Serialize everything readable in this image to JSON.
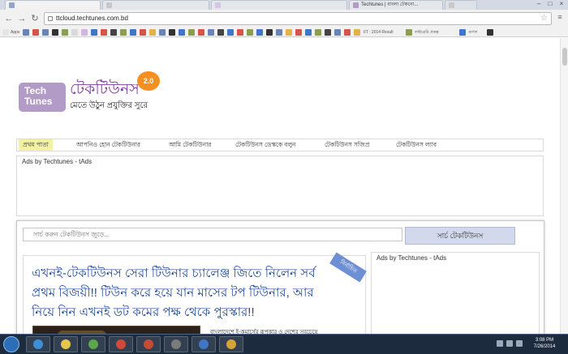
{
  "browser": {
    "tabs": [
      {
        "title": "",
        "active": true
      },
      {
        "title": "",
        "active": false
      },
      {
        "title": "Techtunes | বাংলা টেকনো...",
        "active": false
      },
      {
        "title": "",
        "active": false
      }
    ],
    "url": "ttcloud.techtunes.com.bd",
    "bookmarks": [
      "Apps",
      "",
      "",
      "",
      "",
      "",
      "",
      "",
      "",
      "",
      "",
      "",
      "",
      "",
      "",
      "",
      "",
      "",
      "",
      "",
      "",
      "",
      "",
      "",
      "",
      "",
      "IIT : 2014 Result",
      "",
      "লাইব্রেরি প্রকল্প",
      "",
      "গুগল",
      ""
    ]
  },
  "site": {
    "logo_text": "Tech Tunes",
    "logo_name": "টেকটিউনস",
    "logo_badge": "2.0",
    "tagline": "মেতে উঠুন প্রযুক্তির সুরে",
    "nav": [
      "প্রথম পাতা",
      "আপনিও হোন টেকটিউনার",
      "আমি টেকটিউনার",
      "টেকটিউনস ডেস্ককে বলুন",
      "টেকটিউনস সজিপ্র",
      "টেকটিউনস ল্যাব"
    ],
    "ads_top_label": "Ads by Techtunes - tAds",
    "search_placeholder": "সার্চ করুন টেকটিউনস জুড়ে...",
    "search_button": "সার্চ টেকটিউনস",
    "headline": "এখনই-টেকটিউনস সেরা টিউনার চ্যালেঞ্জ জিতে নিলেন সর্ব প্রথম বিজয়ী!! টিউন করে হয়ে যান মাসের টপ টিউনার, আর নিয়ে নিন এখনই ডট কমের পক্ষ থেকে পুরস্কার!!",
    "stamp": "নির্বাচিত",
    "excerpt": "বাংলাদেশে ই-কমার্সের রূপকার ও দেশের সবচেয়ে",
    "ads_side_label": "Ads by Techtunes - tAds"
  },
  "taskbar": {
    "time": "3:08 PM",
    "date": "7/26/2014"
  },
  "colors": {
    "accent_purple": "#7f3ea0",
    "logo_bg": "#b29cc7",
    "badge_orange": "#f49021",
    "headline_blue": "#1f4a97",
    "nav_active": "#f3f1a4",
    "search_button_bg": "#d2d9ec"
  }
}
